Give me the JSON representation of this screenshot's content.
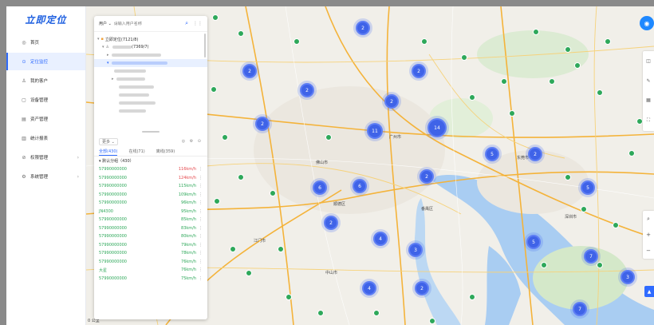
{
  "sidebar": {
    "logo": "立即定位",
    "items": [
      {
        "label": "首页",
        "icon": "home-icon",
        "glyph": "◎",
        "active": false,
        "chevron": false
      },
      {
        "label": "定位监控",
        "icon": "location-icon",
        "glyph": "⊙",
        "active": true,
        "chevron": false
      },
      {
        "label": "我的客户",
        "icon": "user-icon",
        "glyph": "♙",
        "active": false,
        "chevron": false
      },
      {
        "label": "设备管理",
        "icon": "device-icon",
        "glyph": "▢",
        "active": false,
        "chevron": false
      },
      {
        "label": "资产管理",
        "icon": "asset-icon",
        "glyph": "▤",
        "active": false,
        "chevron": false
      },
      {
        "label": "统计报表",
        "icon": "report-icon",
        "glyph": "▥",
        "active": false,
        "chevron": false
      },
      {
        "label": "权限管理",
        "icon": "permission-icon",
        "glyph": "⊘",
        "active": false,
        "chevron": true
      },
      {
        "label": "系统管理",
        "icon": "settings-icon",
        "glyph": "⚙",
        "active": false,
        "chevron": true
      }
    ]
  },
  "panel": {
    "search_scope": "用户 ⌄",
    "search_placeholder": "请输入用户名称",
    "tree": {
      "root_label": "立即定位(7121/8)",
      "child_label": "(7369/7)"
    },
    "list_filter": "更多 ⌄",
    "list_tools": "◎ ⚙ ⊙",
    "status_tabs": [
      "全部(430)",
      "在线(71)",
      "离线(359)"
    ],
    "group_label": "▾ 默认分组（430）",
    "devices": [
      {
        "name": "57990000000",
        "speed": "116km/h",
        "warn": true
      },
      {
        "name": "57990000000",
        "speed": "124km/h",
        "warn": true
      },
      {
        "name": "57990000000",
        "speed": "115km/h",
        "warn": false
      },
      {
        "name": "57990000000",
        "speed": "109km/h",
        "warn": false
      },
      {
        "name": "57990000000",
        "speed": "96km/h",
        "warn": false
      },
      {
        "name": "JN4300",
        "speed": "95km/h",
        "warn": false
      },
      {
        "name": "57990000000",
        "speed": "85km/h",
        "warn": false
      },
      {
        "name": "57990000000",
        "speed": "83km/h",
        "warn": false
      },
      {
        "name": "57990000000",
        "speed": "80km/h",
        "warn": false
      },
      {
        "name": "57990000000",
        "speed": "79km/h",
        "warn": false
      },
      {
        "name": "57990000000",
        "speed": "78km/h",
        "warn": false
      },
      {
        "name": "57990000000",
        "speed": "76km/h",
        "warn": false
      },
      {
        "name": "大星",
        "speed": "76km/h",
        "warn": false
      },
      {
        "name": "57990000000",
        "speed": "75km/h",
        "warn": false
      }
    ]
  },
  "map": {
    "scale_label": "0 公里",
    "clusters": [
      "2",
      "2",
      "2",
      "2",
      "2",
      "14",
      "11",
      "2",
      "5",
      "2",
      "6",
      "6",
      "5",
      "2",
      "4",
      "3",
      "5",
      "7",
      "4",
      "2",
      "3",
      "7",
      "2"
    ],
    "places": [
      "佛山市",
      "广州市",
      "东莞市",
      "中山市",
      "江门市",
      "深圳市",
      "顺德区",
      "番禺区"
    ]
  },
  "colors": {
    "accent": "#2f6bff",
    "cluster": "#3f63e8",
    "online": "#2ea85a",
    "warn": "#e5484d"
  }
}
